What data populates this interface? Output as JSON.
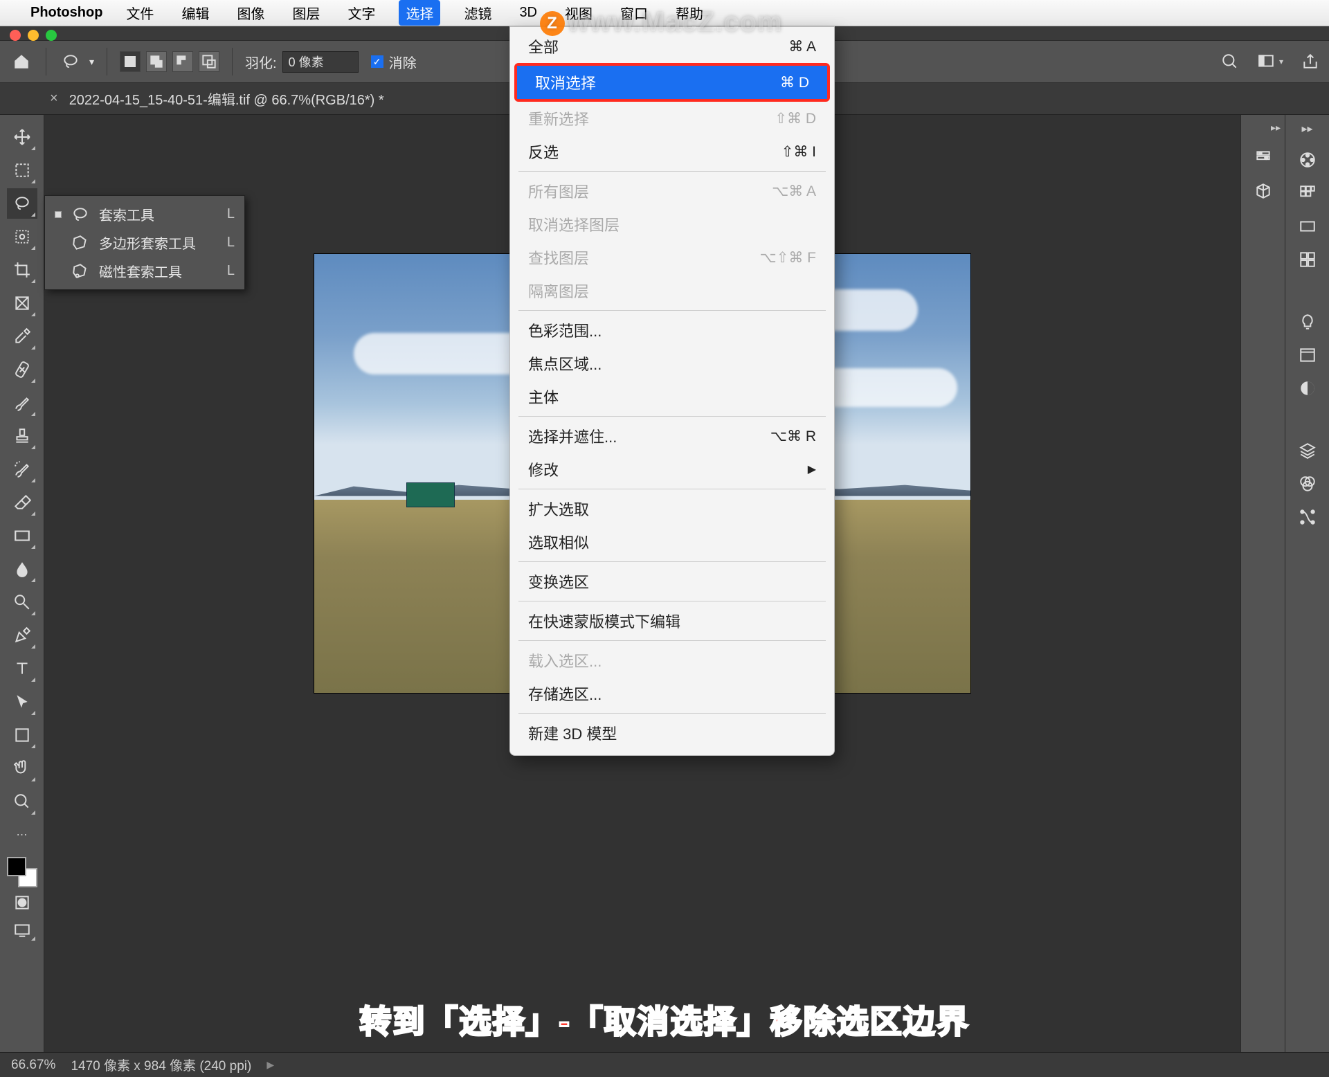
{
  "mac_menu": {
    "appname": "Photoshop",
    "items": [
      "文件",
      "编辑",
      "图像",
      "图层",
      "文字",
      "选择",
      "滤镜",
      "3D",
      "视图",
      "窗口",
      "帮助"
    ],
    "active_index": 5
  },
  "watermark": {
    "prefix": "Z",
    "text": "www.MacZ.com"
  },
  "options_bar": {
    "feather_label": "羽化:",
    "feather_value": "0 像素",
    "antialias_label": "消除"
  },
  "doc_tab": {
    "title": "2022-04-15_15-40-51-编辑.tif @ 66.7%(RGB/16*) *"
  },
  "lasso_flyout": {
    "items": [
      {
        "label": "套索工具",
        "key": "L",
        "selected": true
      },
      {
        "label": "多边形套索工具",
        "key": "L",
        "selected": false
      },
      {
        "label": "磁性套索工具",
        "key": "L",
        "selected": false
      }
    ]
  },
  "dropdown": {
    "rows": [
      {
        "label": "全部",
        "shortcut": "⌘ A",
        "type": "item"
      },
      {
        "label": "取消选择",
        "shortcut": "⌘ D",
        "type": "highlight"
      },
      {
        "label": "重新选择",
        "shortcut": "⇧⌘ D",
        "type": "disabled"
      },
      {
        "label": "反选",
        "shortcut": "⇧⌘ I",
        "type": "item"
      },
      {
        "type": "sep"
      },
      {
        "label": "所有图层",
        "shortcut": "⌥⌘ A",
        "type": "disabled"
      },
      {
        "label": "取消选择图层",
        "shortcut": "",
        "type": "disabled"
      },
      {
        "label": "查找图层",
        "shortcut": "⌥⇧⌘ F",
        "type": "disabled"
      },
      {
        "label": "隔离图层",
        "shortcut": "",
        "type": "disabled"
      },
      {
        "type": "sep"
      },
      {
        "label": "色彩范围...",
        "shortcut": "",
        "type": "item"
      },
      {
        "label": "焦点区域...",
        "shortcut": "",
        "type": "item"
      },
      {
        "label": "主体",
        "shortcut": "",
        "type": "item"
      },
      {
        "type": "sep"
      },
      {
        "label": "选择并遮住...",
        "shortcut": "⌥⌘ R",
        "type": "item"
      },
      {
        "label": "修改",
        "shortcut": "",
        "type": "submenu"
      },
      {
        "type": "sep"
      },
      {
        "label": "扩大选取",
        "shortcut": "",
        "type": "item"
      },
      {
        "label": "选取相似",
        "shortcut": "",
        "type": "item"
      },
      {
        "type": "sep"
      },
      {
        "label": "变换选区",
        "shortcut": "",
        "type": "item"
      },
      {
        "type": "sep"
      },
      {
        "label": "在快速蒙版模式下编辑",
        "shortcut": "",
        "type": "item"
      },
      {
        "type": "sep"
      },
      {
        "label": "载入选区...",
        "shortcut": "",
        "type": "disabled"
      },
      {
        "label": "存储选区...",
        "shortcut": "",
        "type": "item"
      },
      {
        "type": "sep"
      },
      {
        "label": "新建 3D 模型",
        "shortcut": "",
        "type": "item"
      }
    ]
  },
  "status_bar": {
    "zoom": "66.67%",
    "doc_info": "1470 像素 x 984 像素 (240 ppi)"
  },
  "caption": "转到「选择」-「取消选择」移除选区边界"
}
